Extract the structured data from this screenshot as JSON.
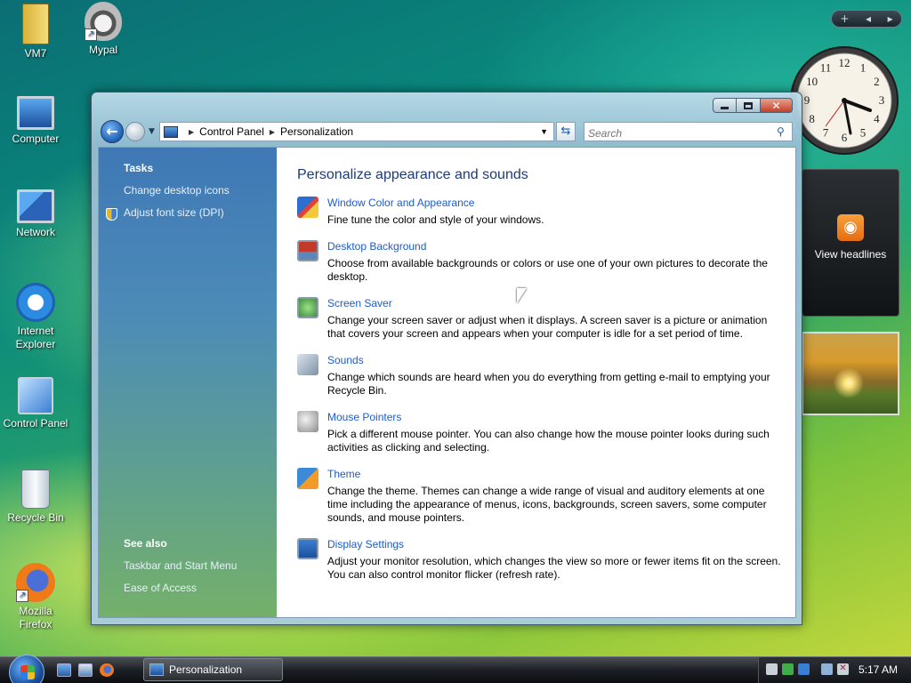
{
  "desktop": {
    "icons": [
      {
        "label": "VM7"
      },
      {
        "label": "Mypal"
      },
      {
        "label": "Computer"
      },
      {
        "label": "Network"
      },
      {
        "label": "Internet Explorer"
      },
      {
        "label": "Control Panel"
      },
      {
        "label": "Recycle Bin"
      },
      {
        "label": "Mozilla Firefox"
      }
    ]
  },
  "gadgets": {
    "feed_label": "View headlines",
    "clock_numbers": [
      "12",
      "1",
      "2",
      "3",
      "4",
      "5",
      "6",
      "7",
      "8",
      "9",
      "10",
      "11"
    ]
  },
  "window": {
    "breadcrumb": [
      "Control Panel",
      "Personalization"
    ],
    "search_placeholder": "Search",
    "tasks": {
      "heading": "Tasks",
      "links": [
        "Change desktop icons",
        "Adjust font size (DPI)"
      ]
    },
    "see_also": {
      "heading": "See also",
      "links": [
        "Taskbar and Start Menu",
        "Ease of Access"
      ]
    },
    "title": "Personalize appearance and sounds",
    "items": [
      {
        "name": "Window Color and Appearance",
        "desc": "Fine tune the color and style of your windows.",
        "icon": "window-color-icon"
      },
      {
        "name": "Desktop Background",
        "desc": "Choose from available backgrounds or colors or use one of your own pictures to decorate the desktop.",
        "icon": "desktop-background-icon"
      },
      {
        "name": "Screen Saver",
        "desc": "Change your screen saver or adjust when it displays. A screen saver is a picture or animation that covers your screen and appears when your computer is idle for a set period of time.",
        "icon": "screen-saver-icon"
      },
      {
        "name": "Sounds",
        "desc": "Change which sounds are heard when you do everything from getting e-mail to emptying your Recycle Bin.",
        "icon": "sounds-icon"
      },
      {
        "name": "Mouse Pointers",
        "desc": "Pick a different mouse pointer. You can also change how the mouse pointer looks during such activities as clicking and selecting.",
        "icon": "mouse-pointers-icon"
      },
      {
        "name": "Theme",
        "desc": "Change the theme. Themes can change a wide range of visual and auditory elements at one time including the appearance of menus, icons, backgrounds, screen savers, some computer sounds, and mouse pointers.",
        "icon": "theme-icon"
      },
      {
        "name": "Display Settings",
        "desc": "Adjust your monitor resolution, which changes the view so more or fewer items fit on the screen. You can also control monitor flicker (refresh rate).",
        "icon": "display-settings-icon"
      }
    ]
  },
  "taskbar": {
    "active_window": "Personalization",
    "time": "5:17 AM"
  }
}
